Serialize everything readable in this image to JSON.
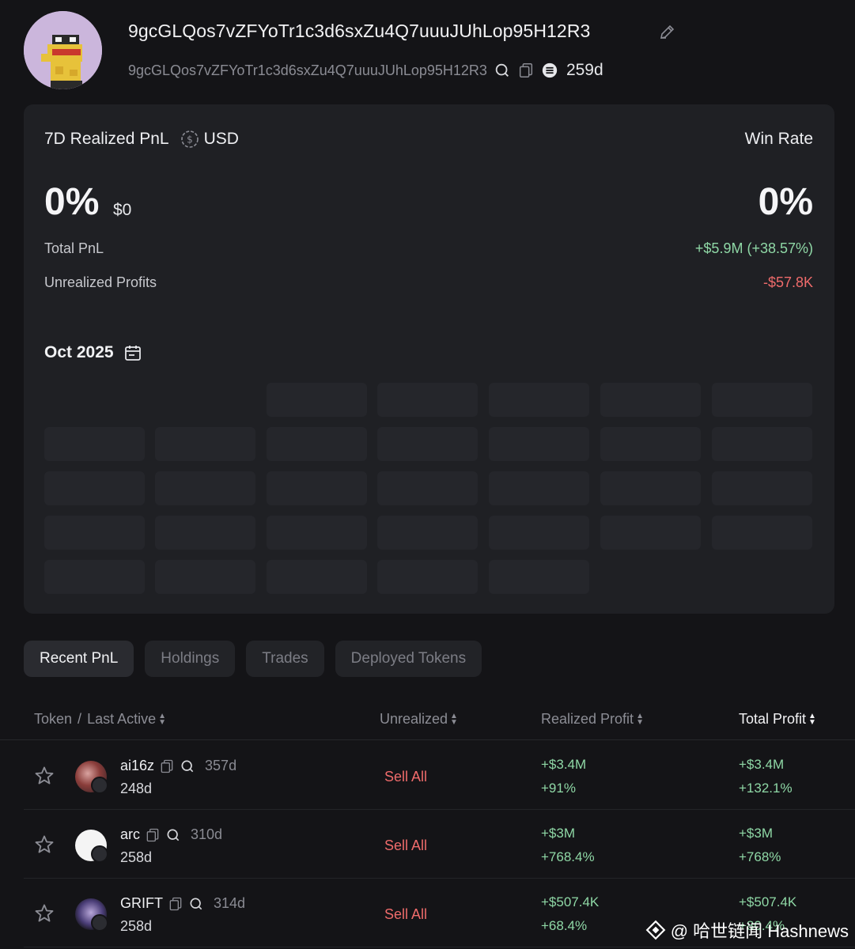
{
  "header": {
    "wallet_name": "9gcGLQos7vZFYoTr1c3d6sxZu4Q7uuuJUhLop95H12R3",
    "address": "9gcGLQos7vZFYoTr1c3d6sxZu4Q7uuuJUhLop95H12R3",
    "wallet_age": "259d"
  },
  "stats": {
    "pnl_label": "7D Realized PnL",
    "currency": "USD",
    "win_rate_label": "Win Rate",
    "pnl_percent": "0%",
    "pnl_usd": "$0",
    "win_rate": "0%",
    "total_pnl_label": "Total PnL",
    "total_pnl_value": "+$5.9M (+38.57%)",
    "unrealized_label": "Unrealized Profits",
    "unrealized_value": "-$57.8K",
    "month": "Oct 2025"
  },
  "tabs": [
    "Recent PnL",
    "Holdings",
    "Trades",
    "Deployed Tokens"
  ],
  "table": {
    "headers": {
      "token": "Token",
      "last_active": "Last Active",
      "unrealized": "Unrealized",
      "realized": "Realized Profit",
      "total": "Total Profit"
    },
    "rows": [
      {
        "name": "ai16z",
        "age": "357d",
        "last_active": "248d",
        "action": "Sell All",
        "realized": "+$3.4M",
        "realized_pct": "+91%",
        "total": "+$3.4M",
        "total_pct": "+132.1%"
      },
      {
        "name": "arc",
        "age": "310d",
        "last_active": "258d",
        "action": "Sell All",
        "realized": "+$3M",
        "realized_pct": "+768.4%",
        "total": "+$3M",
        "total_pct": "+768%"
      },
      {
        "name": "GRIFT",
        "age": "314d",
        "last_active": "258d",
        "action": "Sell All",
        "realized": "+$507.4K",
        "realized_pct": "+68.4%",
        "total": "+$507.4K",
        "total_pct": "+80.4%"
      }
    ]
  },
  "watermark": "@ 哈世链闻 Hashnews",
  "colors": {
    "positive": "#8fd8a6",
    "negative": "#ef6b6b",
    "background": "#141417",
    "card": "#1f2024"
  }
}
